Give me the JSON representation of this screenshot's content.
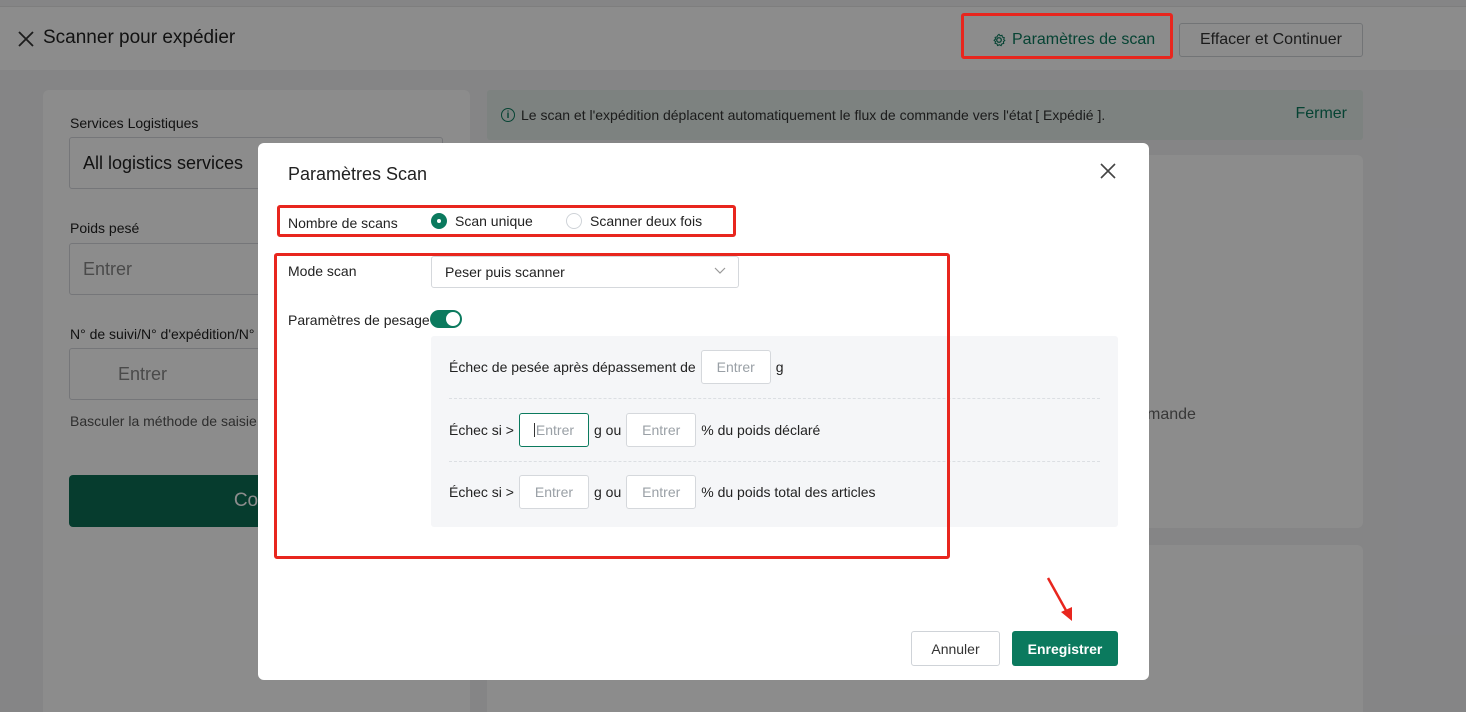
{
  "page": {
    "title": "Scanner pour expédier",
    "scan_settings_label": "Paramètres de scan",
    "clear_label": "Effacer et Continuer"
  },
  "left_panel": {
    "logistics_label": "Services Logistiques",
    "logistics_value": "All logistics services",
    "weight_label": "Poids pesé",
    "weight_placeholder": "Entrer",
    "tracking_label": "N° de suivi/N° d'expédition/N°",
    "tracking_placeholder": "Entrer",
    "switch_hint": "Basculer la méthode de saisie",
    "confirm_label": "Confi"
  },
  "banner": {
    "text": "Le scan et l'expédition déplacent automatiquement le flux de commande vers l'état",
    "status": "[ Expédié ].",
    "close_label": "Fermer"
  },
  "right_card": {
    "partial_text": "mande"
  },
  "modal": {
    "title": "Paramètres Scan",
    "scan_count_label": "Nombre de scans",
    "radio_single": "Scan unique",
    "radio_double": "Scanner deux fois",
    "mode_label": "Mode scan",
    "mode_value": "Peser puis scanner",
    "weigh_label": "Paramètres de pesage",
    "row1_prefix": "Échec de pesée après dépassement de",
    "row1_suffix": "g",
    "row2_prefix": "Échec si >",
    "row2_mid": "g ou",
    "row2_suffix": "% du poids déclaré",
    "row3_prefix": "Échec si >",
    "row3_mid": "g ou",
    "row3_suffix": "% du poids total des articles",
    "input_placeholder": "Entrer",
    "cancel_label": "Annuler",
    "save_label": "Enregistrer"
  },
  "colors": {
    "accent": "#0b7a5e",
    "highlight": "#e8261e"
  }
}
